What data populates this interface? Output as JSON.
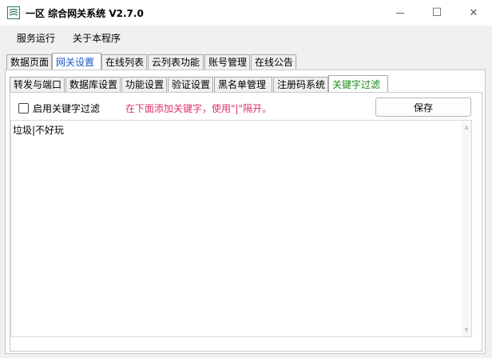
{
  "window": {
    "title": "一区 综合网关系统 V2.7.0",
    "minimize_glyph": "—",
    "maximize_glyph": "☐",
    "close_glyph": "✕"
  },
  "menu": {
    "items": [
      {
        "label": "服务运行"
      },
      {
        "label": "关于本程序"
      }
    ]
  },
  "main_tabs": [
    {
      "label": "数据页面",
      "active": false
    },
    {
      "label": "网关设置",
      "active": true
    },
    {
      "label": "在线列表",
      "active": false
    },
    {
      "label": "云列表功能",
      "active": false
    },
    {
      "label": "账号管理",
      "active": false
    },
    {
      "label": "在线公告",
      "active": false
    }
  ],
  "sub_tabs": [
    {
      "label": "转发与端口",
      "active": false
    },
    {
      "label": "数据库设置",
      "active": false
    },
    {
      "label": "功能设置",
      "active": false
    },
    {
      "label": "验证设置",
      "active": false
    },
    {
      "label": "黑名单管理",
      "active": false
    },
    {
      "label": "注册码系统",
      "active": false
    },
    {
      "label": "关键字过滤",
      "active": true
    }
  ],
  "keyword_filter": {
    "enable_label": "启用关键字过滤",
    "enabled": false,
    "hint": "在下面添加关键字，使用\"|\"隔开。",
    "save_label": "保存",
    "content": "垃圾|不好玩"
  },
  "colors": {
    "active_tab_text": "#1a58c7",
    "active_subtab_text": "#1e8a1e",
    "hint_text": "#e0306a"
  }
}
